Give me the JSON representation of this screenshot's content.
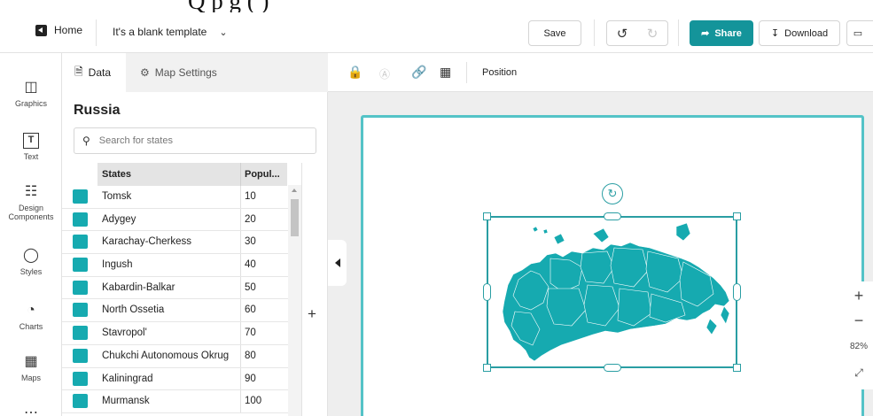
{
  "caption_fragment": "Q          p  g  (        )",
  "header": {
    "home_label": "Home",
    "template_name": "It's a blank template",
    "save_label": "Save",
    "share_label": "Share",
    "download_label": "Download",
    "accent_color": "#14949a"
  },
  "rail": {
    "items": [
      {
        "label": "Graphics",
        "icon": "graphics-icon"
      },
      {
        "label": "Text",
        "icon": "text-icon"
      },
      {
        "label": "Design Components",
        "icon": "components-icon"
      },
      {
        "label": "Styles",
        "icon": "palette-icon"
      },
      {
        "label": "Charts",
        "icon": "pie-chart-icon"
      },
      {
        "label": "Maps",
        "icon": "map-icon"
      }
    ]
  },
  "panel": {
    "tabs": [
      {
        "label": "Data",
        "icon": "file-icon",
        "active": true
      },
      {
        "label": "Map Settings",
        "icon": "gear-icon",
        "active": false
      }
    ],
    "country": "Russia",
    "search_placeholder": "Search for states",
    "columns": [
      "States",
      "Popul..."
    ],
    "rows": [
      {
        "state": "Tomsk",
        "value": "10"
      },
      {
        "state": "Adygey",
        "value": "20"
      },
      {
        "state": "Karachay-Cherkess",
        "value": "30"
      },
      {
        "state": "Ingush",
        "value": "40"
      },
      {
        "state": "Kabardin-Balkar",
        "value": "50"
      },
      {
        "state": "North Ossetia",
        "value": "60"
      },
      {
        "state": "Stavropol'",
        "value": "70"
      },
      {
        "state": "Chukchi Autonomous Okrug",
        "value": "80"
      },
      {
        "state": "Kaliningrad",
        "value": "90"
      },
      {
        "state": "Murmansk",
        "value": "100"
      }
    ],
    "swatch_color": "#16aab0",
    "add_column": "+"
  },
  "toolbar": {
    "position_label": "Position"
  },
  "zoom": {
    "plus": "+",
    "minus": "−",
    "level": "82%"
  },
  "map_color": "#16aab0"
}
